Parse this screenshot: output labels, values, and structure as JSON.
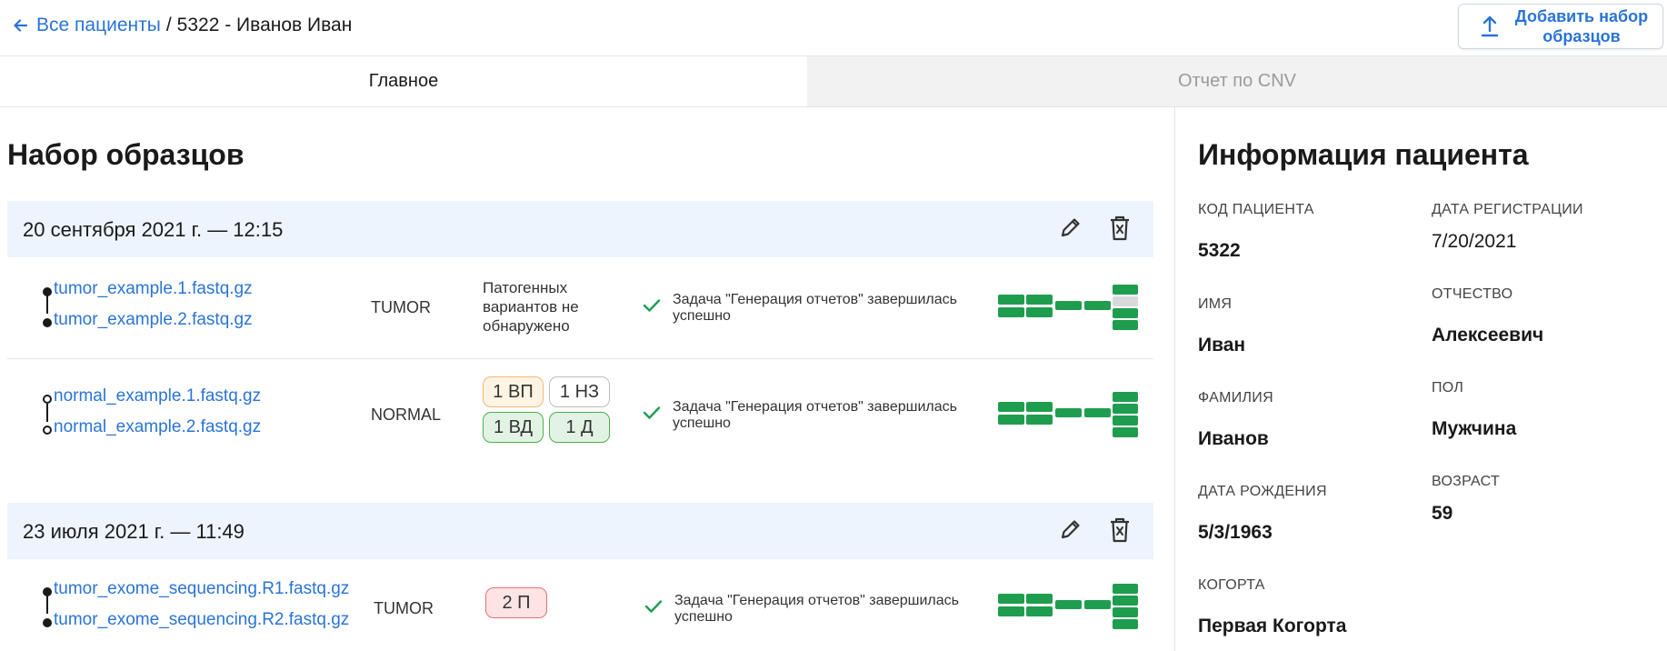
{
  "breadcrumb": {
    "back_label": "Все пациенты",
    "separator": "/",
    "current": "5322 - Иванов Иван"
  },
  "toolbar": {
    "add_label": "Добавить набор образцов"
  },
  "tabs": [
    {
      "label": "Главное",
      "active": true
    },
    {
      "label": "Отчет по CNV",
      "active": false
    }
  ],
  "samples": {
    "title": "Набор образцов",
    "groups": [
      {
        "date": "20 сентября 2021 г. — 12:15",
        "rows": [
          {
            "files": [
              "tumor_example.1.fastq.gz",
              "tumor_example.2.fastq.gz"
            ],
            "type": "TUMOR",
            "pathogenic": "Патогенных вариантов не обнаружено",
            "status": "Задача \"Генерация отчетов\" завершилась успешно"
          },
          {
            "files": [
              "normal_example.1.fastq.gz",
              "normal_example.2.fastq.gz"
            ],
            "type": "NORMAL",
            "badges": [
              "1 ВП",
              "1 НЗ",
              "1 ВД",
              "1 Д"
            ],
            "status": "Задача \"Генерация отчетов\" завершилась успешно"
          }
        ]
      },
      {
        "date": "23 июля 2021 г. — 11:49",
        "rows": [
          {
            "files": [
              "tumor_exome_sequencing.R1.fastq.gz",
              "tumor_exome_sequencing.R2.fastq.gz"
            ],
            "type": "TUMOR",
            "badges": [
              "2 П"
            ],
            "status": "Задача \"Генерация отчетов\" завершилась успешно"
          }
        ]
      }
    ]
  },
  "patient": {
    "title": "Информация пациента",
    "fields": {
      "code": {
        "label": "КОД ПАЦИЕНТА",
        "value": "5322"
      },
      "registered": {
        "label": "ДАТА РЕГИСТРАЦИИ",
        "value": "7/20/2021"
      },
      "first_name": {
        "label": "ИМЯ",
        "value": "Иван"
      },
      "patronymic": {
        "label": "ОТЧЕСТВО",
        "value": "Алексеевич"
      },
      "last_name": {
        "label": "ФАМИЛИЯ",
        "value": "Иванов"
      },
      "sex": {
        "label": "ПОЛ",
        "value": "Мужчина"
      },
      "birth_date": {
        "label": "ДАТА РОЖДЕНИЯ",
        "value": "5/3/1963"
      },
      "age": {
        "label": "ВОЗРАСТ",
        "value": "59"
      },
      "cohort": {
        "label": "КОГОРТА",
        "value": "Первая Когорта"
      }
    }
  },
  "colors": {
    "link": "#2a74d6",
    "success": "#1f9d4f",
    "group_bg": "#edf4fd"
  },
  "icons": [
    "arrow-left-icon",
    "upload-icon",
    "pencil-icon",
    "trash-icon",
    "check-icon",
    "pipeline-progress-icon"
  ]
}
